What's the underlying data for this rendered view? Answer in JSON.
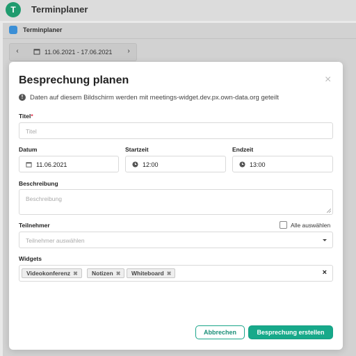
{
  "app": {
    "title": "Terminplaner",
    "logo_letter": "T"
  },
  "panel": {
    "title": "Terminplaner",
    "date_range": "11.06.2021 - 17.06.2021"
  },
  "modal": {
    "title": "Besprechung planen",
    "info": "Daten auf diesem Bildschirm werden mit meetings-widget.dev.px.own-data.org geteilt",
    "fields": {
      "title": {
        "label": "Titel",
        "required_mark": "*",
        "placeholder": "Titel"
      },
      "date": {
        "label": "Datum",
        "value": "11.06.2021"
      },
      "start": {
        "label": "Startzeit",
        "value": "12:00"
      },
      "end": {
        "label": "Endzeit",
        "value": "13:00"
      },
      "description": {
        "label": "Beschreibung",
        "placeholder": "Beschreibung"
      },
      "participants": {
        "label": "Teilnehmer",
        "select_all": "Alle auswählen",
        "placeholder": "Teilnehmer auswählen"
      },
      "widgets": {
        "label": "Widgets",
        "tags": [
          "Videokonferenz",
          "Notizen",
          "Whiteboard"
        ]
      }
    },
    "buttons": {
      "cancel": "Abbrechen",
      "create": "Besprechung erstellen"
    }
  },
  "colors": {
    "accent": "#17a98a",
    "logo": "#1f9b6e",
    "required": "#e0314b"
  }
}
